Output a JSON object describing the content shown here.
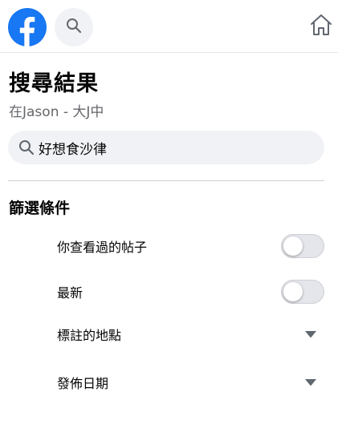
{
  "header": {
    "logo_icon": "facebook-logo-icon",
    "search_icon": "search-icon",
    "home_icon": "home-icon",
    "brand_color": "#1877f2"
  },
  "page": {
    "title": "搜尋結果",
    "subtitle": "在Jason - 大J中"
  },
  "search": {
    "value": "好想食沙律"
  },
  "filters": {
    "section_title": "篩選條件",
    "items": [
      {
        "label": "你查看過的帖子",
        "control": "toggle",
        "on": false
      },
      {
        "label": "最新",
        "control": "toggle",
        "on": false
      },
      {
        "label": "標註的地點",
        "control": "dropdown"
      },
      {
        "label": "發佈日期",
        "control": "dropdown"
      }
    ]
  }
}
